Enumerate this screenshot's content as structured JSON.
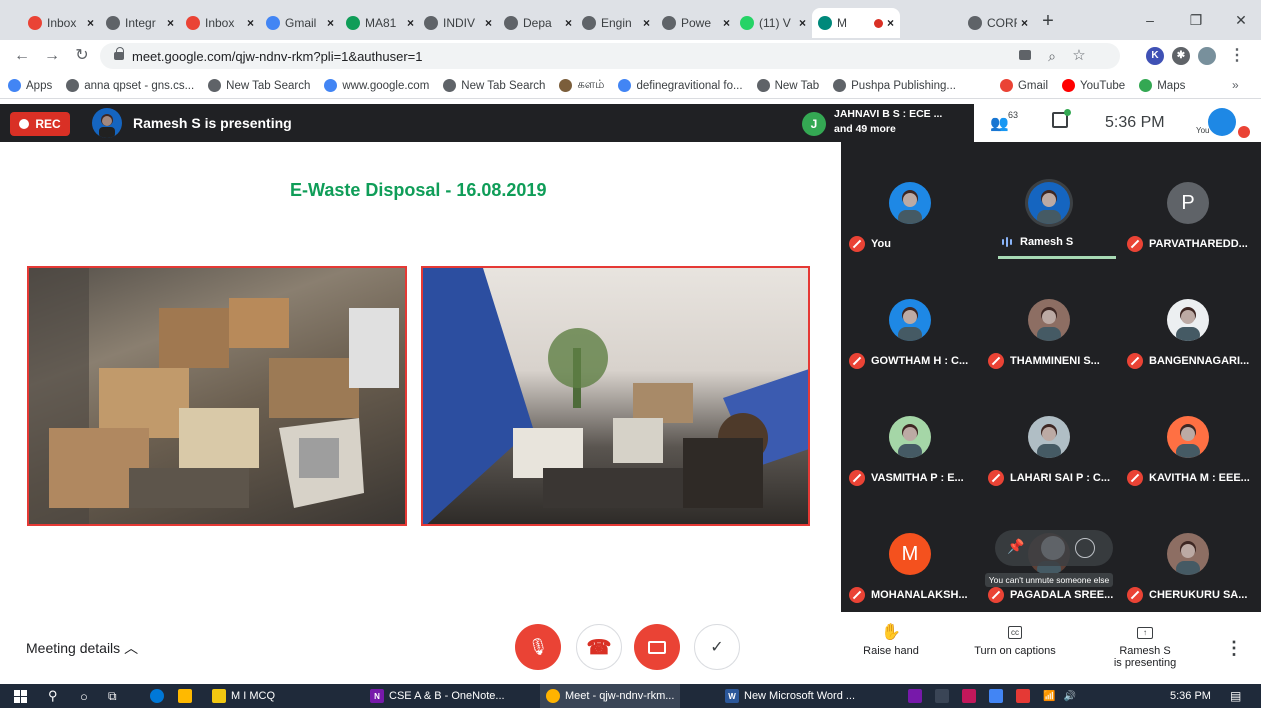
{
  "browser": {
    "tabs": [
      {
        "label": "Inbox",
        "icon": "gmail-icon",
        "color": "#ea4335"
      },
      {
        "label": "Integr",
        "icon": "globe-icon",
        "color": "#5f6368"
      },
      {
        "label": "Inbox",
        "icon": "gmail-icon",
        "color": "#ea4335"
      },
      {
        "label": "Gmail",
        "icon": "google-icon",
        "color": "#4285f4"
      },
      {
        "label": "MA81",
        "icon": "classroom-icon",
        "color": "#0f9d58"
      },
      {
        "label": "INDIV",
        "icon": "globe-icon",
        "color": "#5f6368"
      },
      {
        "label": "Depa",
        "icon": "globe-icon",
        "color": "#5f6368"
      },
      {
        "label": "Engin",
        "icon": "globe-icon",
        "color": "#5f6368"
      },
      {
        "label": "Powe",
        "icon": "globe-icon",
        "color": "#5f6368"
      },
      {
        "label": "(11) V",
        "icon": "whatsapp-icon",
        "color": "#25d366"
      },
      {
        "label": "M",
        "icon": "meet-icon",
        "color": "#00897b"
      },
      {
        "label": "CORR",
        "icon": "globe-icon",
        "color": "#5f6368"
      }
    ],
    "close_glyph": "×",
    "new_tab_glyph": "+",
    "window_controls": [
      "–",
      "❐",
      "✕"
    ],
    "url": "meet.google.com/qjw-ndnv-rkm?pli=1&authuser=1",
    "bookmarks": [
      {
        "label": "Apps",
        "icon": "apps-grid-icon",
        "color": "#4285f4"
      },
      {
        "label": "anna qpset - gns.cs...",
        "icon": "globe-icon",
        "color": "#5f6368"
      },
      {
        "label": "New Tab Search",
        "icon": "search-icon",
        "color": "#5f6368"
      },
      {
        "label": "www.google.com",
        "icon": "google-icon",
        "color": "#4285f4"
      },
      {
        "label": "New Tab Search",
        "icon": "search-icon",
        "color": "#5f6368"
      },
      {
        "label": "களம்",
        "icon": "site-icon",
        "color": "#7b5e3b"
      },
      {
        "label": "definegravitional fo...",
        "icon": "google-icon",
        "color": "#4285f4"
      },
      {
        "label": "New Tab",
        "icon": "globe-icon",
        "color": "#5f6368"
      },
      {
        "label": "Pushpa Publishing...",
        "icon": "globe-icon",
        "color": "#5f6368"
      },
      {
        "label": "Gmail",
        "icon": "gmail-icon",
        "color": "#ea4335"
      },
      {
        "label": "YouTube",
        "icon": "youtube-icon",
        "color": "#ff0000"
      },
      {
        "label": "Maps",
        "icon": "maps-icon",
        "color": "#34a853"
      }
    ],
    "more_bookmarks": "»"
  },
  "meet": {
    "rec_label": "REC",
    "presenter_text": "Ramesh S is presenting",
    "notif_initial": "J",
    "notif_line1": "JAHNAVI B S : ECE ...",
    "notif_line2": "and 49 more",
    "people_count": "63",
    "time": "5:36 PM",
    "you_label": "You",
    "slide_title": "E-Waste Disposal - 16.08.2019",
    "participants": [
      {
        "name": "You",
        "muted": true,
        "initial": "",
        "color": "#1e88e5"
      },
      {
        "name": "Ramesh S",
        "muted": false,
        "initial": "",
        "color": "#1565c0"
      },
      {
        "name": "PARVATHAREDD...",
        "muted": true,
        "initial": "P",
        "color": "#5f6368"
      },
      {
        "name": "GOWTHAM H : C...",
        "muted": true,
        "initial": "",
        "color": "#1e88e5"
      },
      {
        "name": "THAMMINENI S...",
        "muted": true,
        "initial": "",
        "color": "#8d6e63"
      },
      {
        "name": "BANGENNAGARI...",
        "muted": true,
        "initial": "",
        "color": "#eceff1"
      },
      {
        "name": "VASMITHA P : E...",
        "muted": true,
        "initial": "",
        "color": "#a5d6a7"
      },
      {
        "name": "LAHARI SAI P : C...",
        "muted": true,
        "initial": "",
        "color": "#b0bec5"
      },
      {
        "name": "KAVITHA M : EEE...",
        "muted": true,
        "initial": "",
        "color": "#ff7043"
      },
      {
        "name": "MOHANALAKSH...",
        "muted": true,
        "initial": "M",
        "color": "#f4511e"
      },
      {
        "name": "PAGADALA SREE...",
        "muted": true,
        "initial": "",
        "color": "#5d4037"
      },
      {
        "name": "CHERUKURU SA...",
        "muted": true,
        "initial": "",
        "color": "#8d6e63"
      }
    ],
    "tooltip": "You can't unmute someone else",
    "meeting_details": "Meeting details",
    "raise_hand": "Raise hand",
    "captions": "Turn on captions",
    "presenting_line1": "Ramesh S",
    "presenting_line2": "is presenting"
  },
  "taskbar": {
    "items": [
      "M I MCQ",
      "CSE A & B - OneNote...",
      "Meet - qjw-ndnv-rkm...",
      "New Microsoft Word ..."
    ],
    "clock": "5:36 PM"
  }
}
